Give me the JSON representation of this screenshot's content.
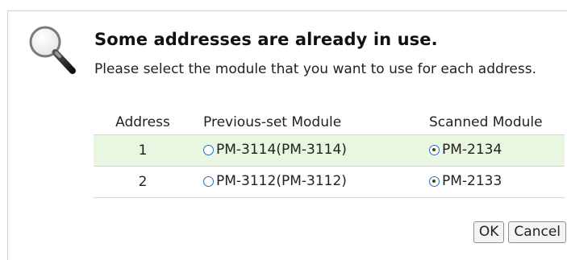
{
  "dialog": {
    "title": "Some addresses are already in use.",
    "message": "Please select the module that you want to use for each address.",
    "icon": "magnifier-icon"
  },
  "table": {
    "headers": {
      "address": "Address",
      "previous": "Previous-set Module",
      "scanned": "Scanned Module"
    },
    "rows": [
      {
        "address": "1",
        "previous": "PM-3114(PM-3114)",
        "previous_selected": false,
        "scanned": "PM-2134",
        "scanned_selected": true
      },
      {
        "address": "2",
        "previous": "PM-3112(PM-3112)",
        "previous_selected": false,
        "scanned": "PM-2133",
        "scanned_selected": true
      }
    ]
  },
  "buttons": {
    "ok": "OK",
    "cancel": "Cancel"
  },
  "colors": {
    "row_highlight": "#e9f7e1",
    "radio_border": "#2f6fb5"
  }
}
